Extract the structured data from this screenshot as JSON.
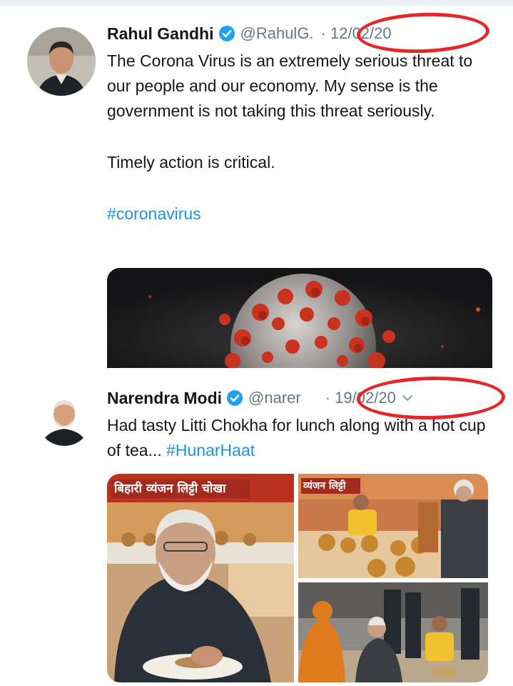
{
  "tweets": [
    {
      "author": "Rahul Gandhi",
      "handle": "@RahulG.",
      "date": "· 12/02/20",
      "paragraphs": [
        "The Corona Virus is an extremely serious threat to our people and our economy. My sense is the government is not taking this threat seriously.",
        "Timely action is critical."
      ],
      "hashtag": "#coronavirus",
      "media": "coronavirus-illustration"
    },
    {
      "author": "Narendra Modi",
      "handle": "@narer",
      "date": "· 19/02/20",
      "text": "Had tasty Litti Chokha for lunch along with a hot cup of tea...",
      "hashtag": "#HunarHaat",
      "media_signs": [
        "बिहारी व्यंजन लिट्टी चोखा",
        "व्यंजन लिट्टी"
      ]
    }
  ],
  "colors": {
    "text": "#14171a",
    "secondary": "#657786",
    "link": "#1b95e0",
    "verified": "#1da1f2",
    "annotation": "#e3282a"
  },
  "icons": [
    "verified-badge-icon",
    "chevron-down-icon"
  ]
}
